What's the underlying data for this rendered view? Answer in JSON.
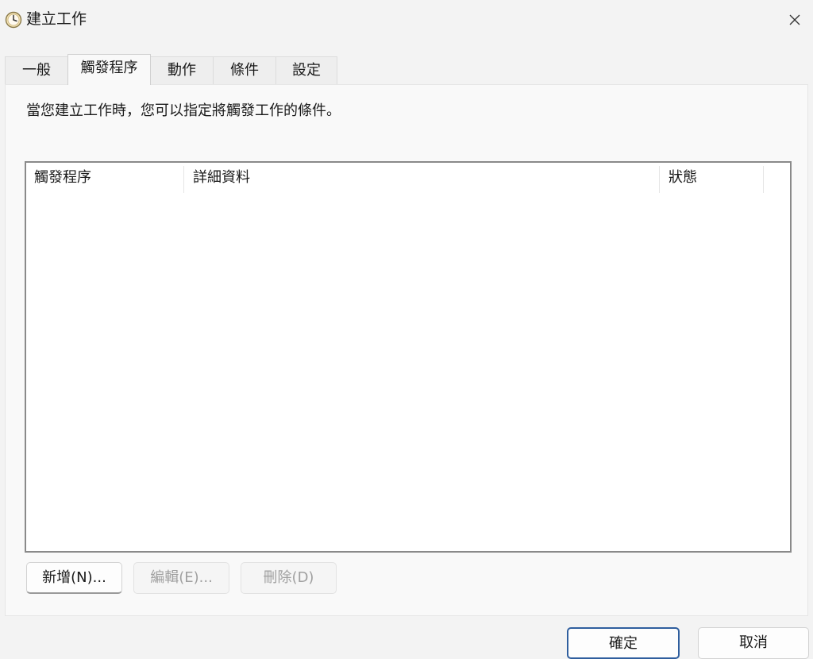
{
  "window": {
    "title": "建立工作",
    "close_label": "關閉"
  },
  "tabs": [
    {
      "label": "一般",
      "active": false
    },
    {
      "label": "觸發程序",
      "active": true
    },
    {
      "label": "動作",
      "active": false
    },
    {
      "label": "條件",
      "active": false
    },
    {
      "label": "設定",
      "active": false
    }
  ],
  "triggers_tab": {
    "description": "當您建立工作時，您可以指定將觸發工作的條件。",
    "columns": [
      "觸發程序",
      "詳細資料",
      "狀態"
    ],
    "rows": [],
    "buttons": {
      "new": "新增(N)...",
      "edit": "編輯(E)...",
      "delete": "刪除(D)"
    }
  },
  "footer": {
    "ok": "確定",
    "cancel": "取消"
  },
  "colors": {
    "background": "#f3f3f3",
    "panel": "#f9f9f9",
    "default_button_border": "#2f5e9e",
    "disabled_text": "#a0a0a0"
  }
}
